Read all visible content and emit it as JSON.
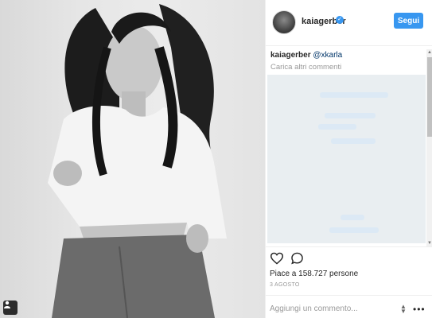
{
  "post": {
    "username": "kaiagerber",
    "follow_label": "Segui",
    "caption_user": "kaiagerber",
    "caption_mention": "@xkarla",
    "load_more_label": "Carica altri commenti",
    "likes_text": "Piace a 158.727 persone",
    "date_text": "3 AGOSTO",
    "comment_placeholder": "Aggiungi un commento...",
    "more_options": "•••"
  },
  "icons": {
    "verified": "verified-badge-icon",
    "like": "heart-icon",
    "comment": "comment-bubble-icon",
    "tag": "user-tag-icon",
    "more": "more-options-icon"
  },
  "colors": {
    "accent": "#3897f0",
    "muted_text": "#999999",
    "mention": "#003569"
  }
}
